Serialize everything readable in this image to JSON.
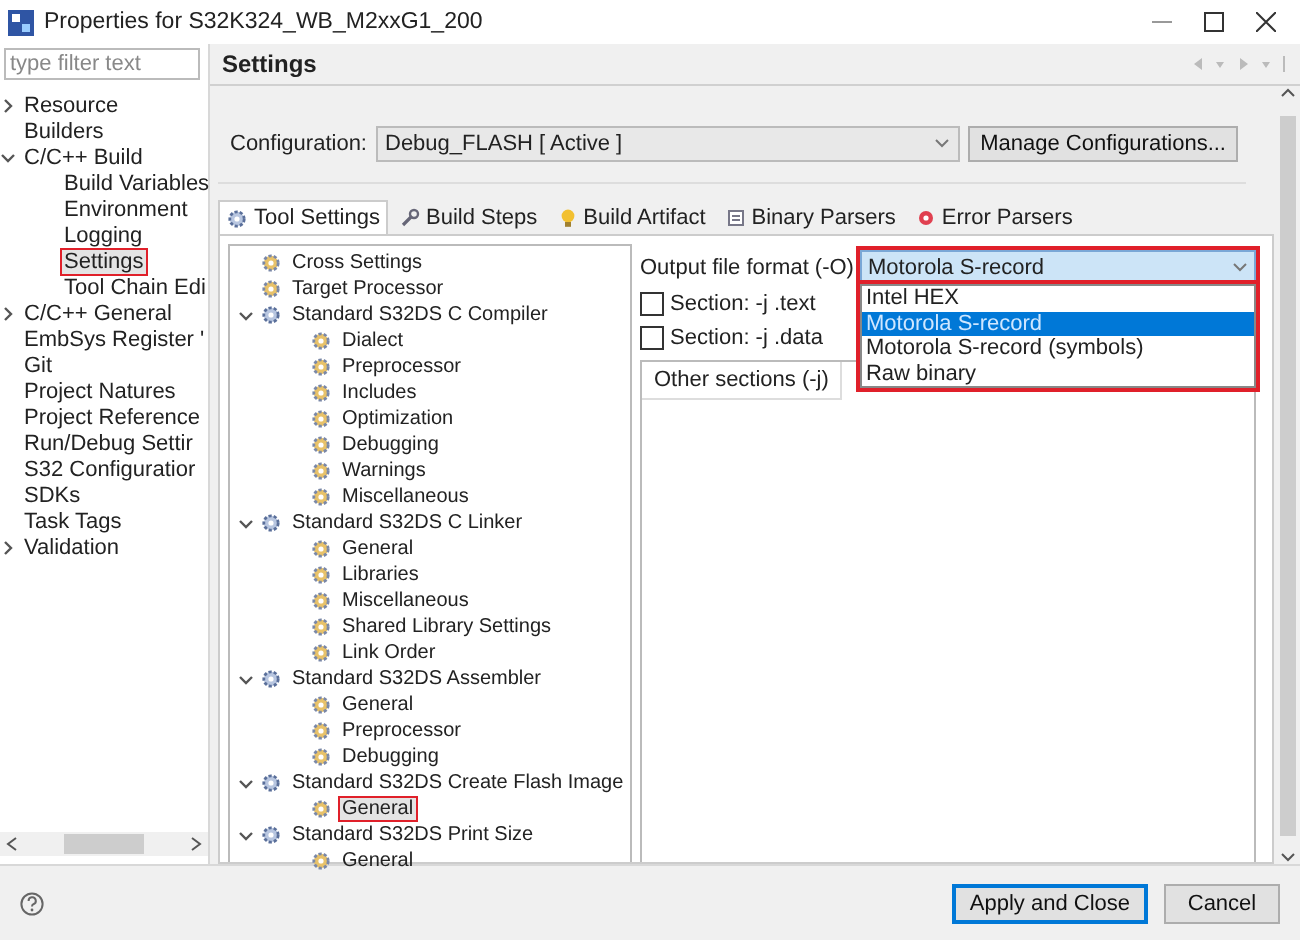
{
  "window": {
    "title": "Properties for S32K324_WB_M2xxG1_200"
  },
  "filter": {
    "placeholder": "type filter text"
  },
  "nav": [
    {
      "label": "Resource",
      "expanded": false,
      "selected": false,
      "highlighted": false
    },
    {
      "label": "Builders",
      "selected": false,
      "highlighted": false
    },
    {
      "label": "C/C++ Build",
      "expanded": true,
      "selected": false,
      "highlighted": false,
      "children": [
        {
          "label": "Build Variables",
          "selected": false,
          "highlighted": false
        },
        {
          "label": "Environment",
          "selected": false,
          "highlighted": false
        },
        {
          "label": "Logging",
          "selected": false,
          "highlighted": false
        },
        {
          "label": "Settings",
          "selected": true,
          "highlighted": true
        },
        {
          "label": "Tool Chain Edi",
          "selected": false,
          "highlighted": false
        }
      ]
    },
    {
      "label": "C/C++ General",
      "expanded": false,
      "selected": false,
      "highlighted": false
    },
    {
      "label": "EmbSys Register '",
      "selected": false,
      "highlighted": false
    },
    {
      "label": "Git",
      "selected": false,
      "highlighted": false
    },
    {
      "label": "Project Natures",
      "selected": false,
      "highlighted": false
    },
    {
      "label": "Project Reference",
      "selected": false,
      "highlighted": false
    },
    {
      "label": "Run/Debug Settir",
      "selected": false,
      "highlighted": false
    },
    {
      "label": "S32 Configuratior",
      "selected": false,
      "highlighted": false
    },
    {
      "label": "SDKs",
      "selected": false,
      "highlighted": false
    },
    {
      "label": "Task Tags",
      "selected": false,
      "highlighted": false
    },
    {
      "label": "Validation",
      "expanded": false,
      "selected": false,
      "highlighted": false
    }
  ],
  "page": {
    "title": "Settings"
  },
  "configuration": {
    "label": "Configuration:",
    "value": "Debug_FLASH  [ Active ]",
    "button": "Manage Configurations..."
  },
  "tabs": [
    {
      "label": "Tool Settings",
      "selected": true
    },
    {
      "label": "Build Steps",
      "selected": false
    },
    {
      "label": "Build Artifact",
      "selected": false
    },
    {
      "label": "Binary Parsers",
      "selected": false
    },
    {
      "label": "Error Parsers",
      "selected": false
    }
  ],
  "tool_tree": [
    {
      "label": "Cross Settings",
      "selected": false,
      "highlighted": false
    },
    {
      "label": "Target Processor",
      "selected": false,
      "highlighted": false
    },
    {
      "label": "Standard S32DS C Compiler",
      "expanded": true,
      "children": [
        {
          "label": "Dialect",
          "selected": false,
          "highlighted": false
        },
        {
          "label": "Preprocessor",
          "selected": false,
          "highlighted": false
        },
        {
          "label": "Includes",
          "selected": false,
          "highlighted": false
        },
        {
          "label": "Optimization",
          "selected": false,
          "highlighted": false
        },
        {
          "label": "Debugging",
          "selected": false,
          "highlighted": false
        },
        {
          "label": "Warnings",
          "selected": false,
          "highlighted": false
        },
        {
          "label": "Miscellaneous",
          "selected": false,
          "highlighted": false
        }
      ]
    },
    {
      "label": "Standard S32DS C Linker",
      "expanded": true,
      "children": [
        {
          "label": "General",
          "selected": false,
          "highlighted": false
        },
        {
          "label": "Libraries",
          "selected": false,
          "highlighted": false
        },
        {
          "label": "Miscellaneous",
          "selected": false,
          "highlighted": false
        },
        {
          "label": "Shared Library Settings",
          "selected": false,
          "highlighted": false
        },
        {
          "label": "Link Order",
          "selected": false,
          "highlighted": false
        }
      ]
    },
    {
      "label": "Standard S32DS Assembler",
      "expanded": true,
      "children": [
        {
          "label": "General",
          "selected": false,
          "highlighted": false
        },
        {
          "label": "Preprocessor",
          "selected": false,
          "highlighted": false
        },
        {
          "label": "Debugging",
          "selected": false,
          "highlighted": false
        }
      ]
    },
    {
      "label": "Standard S32DS Create Flash Image",
      "expanded": true,
      "children": [
        {
          "label": "General",
          "selected": true,
          "highlighted": true
        }
      ]
    },
    {
      "label": "Standard S32DS Print Size",
      "expanded": true,
      "children": [
        {
          "label": "General",
          "selected": false,
          "highlighted": false
        }
      ]
    }
  ],
  "output_format": {
    "label": "Output file format (-O)",
    "value": "Motorola S-record",
    "open": true,
    "highlighted": true,
    "options": [
      {
        "label": "Intel HEX",
        "selected": false
      },
      {
        "label": "Motorola S-record",
        "selected": true
      },
      {
        "label": "Motorola S-record (symbols)",
        "selected": false
      },
      {
        "label": "Raw binary",
        "selected": false
      }
    ]
  },
  "sections": [
    {
      "label": "Section: -j .text",
      "checked": false
    },
    {
      "label": "Section: -j .data",
      "checked": false
    }
  ],
  "other_sections": {
    "header": "Other sections (-j)"
  },
  "buttons": [
    {
      "label": "Apply and Close",
      "default": true
    },
    {
      "label": "Cancel",
      "default": false
    }
  ]
}
